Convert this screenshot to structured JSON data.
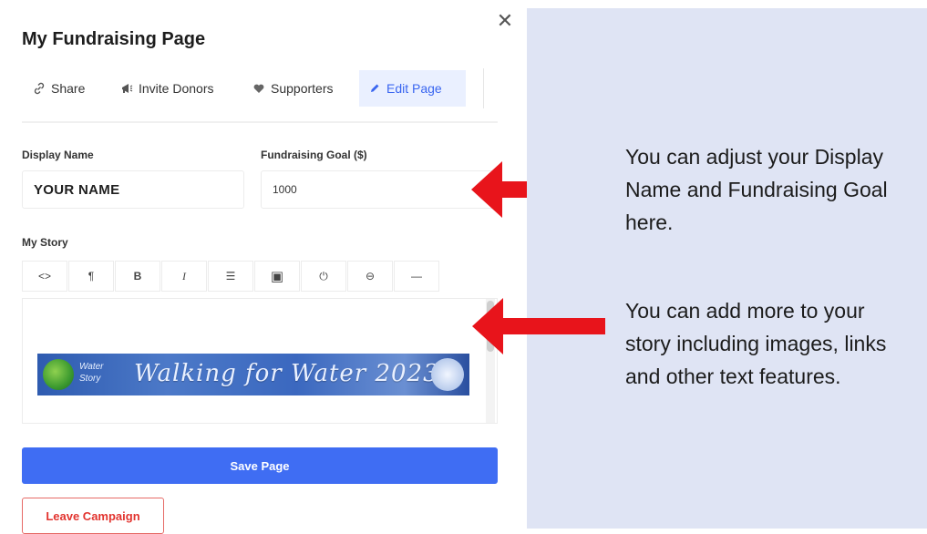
{
  "modal": {
    "title": "My Fundraising Page",
    "close_glyph": "✕"
  },
  "tabs": [
    {
      "label": "Share",
      "icon": "link-icon"
    },
    {
      "label": "Invite Donors",
      "icon": "megaphone-icon"
    },
    {
      "label": "Supporters",
      "icon": "heart-icon"
    },
    {
      "label": "Edit Page",
      "icon": "pencil-icon",
      "active": true
    }
  ],
  "form": {
    "display_name_label": "Display Name",
    "display_name_value": "YOUR NAME",
    "goal_label": "Fundraising Goal ($)",
    "goal_value": "1000",
    "story_label": "My Story"
  },
  "toolbar": {
    "buttons": [
      {
        "icon": "code-icon",
        "glyph": "<>"
      },
      {
        "icon": "paragraph-icon",
        "glyph": "¶"
      },
      {
        "icon": "bold-icon",
        "glyph": "B"
      },
      {
        "icon": "italic-icon",
        "glyph": "I"
      },
      {
        "icon": "list-icon",
        "glyph": "☰"
      },
      {
        "icon": "image-icon",
        "glyph": "▣"
      },
      {
        "icon": "embed-icon",
        "glyph": "⏻"
      },
      {
        "icon": "link-icon",
        "glyph": "⊖"
      },
      {
        "icon": "horizontal-rule-icon",
        "glyph": "—"
      }
    ]
  },
  "story_banner": {
    "brand_line1": "Water",
    "brand_line2": "Story",
    "text": "Walking for Water 2023"
  },
  "actions": {
    "save_label": "Save Page",
    "leave_label": "Leave Campaign"
  },
  "callouts": {
    "first": "You can adjust your Display Name and Fundraising Goal here.",
    "second": "You can add more to your story including images, links and other text features."
  },
  "colors": {
    "accent": "#3f6df3",
    "danger": "#e2342f",
    "arrow": "#e8141b",
    "panel_bg": "#dfe4f4"
  }
}
